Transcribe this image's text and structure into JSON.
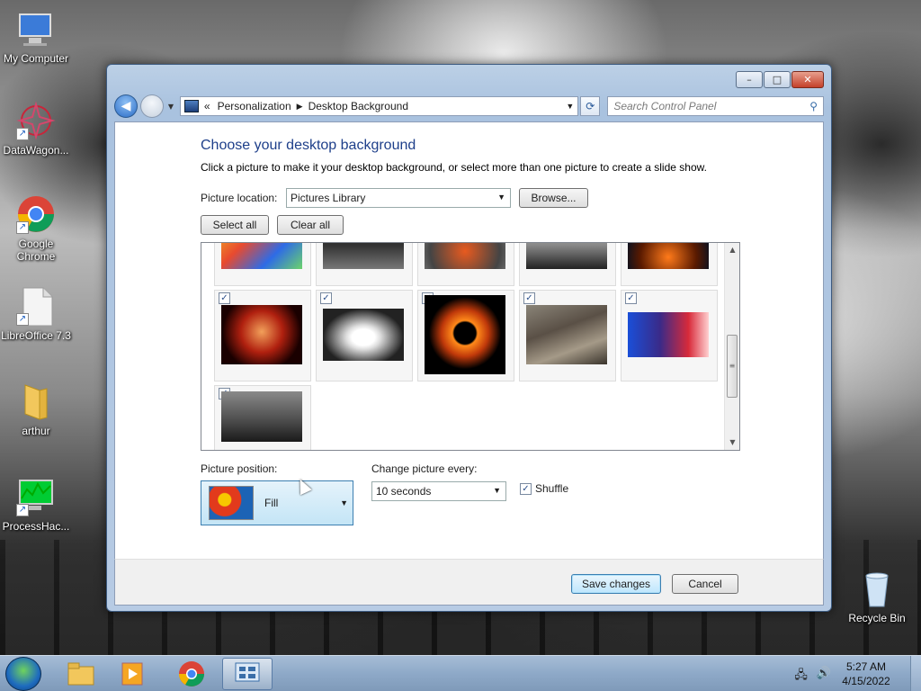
{
  "desktop": {
    "icons": [
      {
        "label": "My Computer"
      },
      {
        "label": "DataWagon..."
      },
      {
        "label": "Google Chrome"
      },
      {
        "label": "LibreOffice 7.3"
      },
      {
        "label": "arthur"
      },
      {
        "label": "ProcessHac..."
      },
      {
        "label": "Recycle Bin"
      }
    ]
  },
  "window": {
    "caption": {
      "minimize": "–",
      "maximize": "□",
      "close": "✕"
    },
    "nav": {
      "back_glyph": "◀",
      "address_prefix": "«",
      "crumb_1": "Personalization",
      "crumb_sep": "▶",
      "crumb_2": "Desktop Background",
      "search_placeholder": "Search Control Panel"
    },
    "heading": "Choose your desktop background",
    "subtitle": "Click a picture to make it your desktop background, or select more than one picture to create a slide show.",
    "picture_location_label": "Picture location:",
    "picture_location_value": "Pictures Library",
    "browse_label": "Browse...",
    "select_all_label": "Select all",
    "clear_all_label": "Clear all",
    "checkmark": "✓",
    "picture_position_label": "Picture position:",
    "picture_position_value": "Fill",
    "change_every_label": "Change picture every:",
    "change_every_value": "10 seconds",
    "shuffle_label": "Shuffle",
    "save_label": "Save changes",
    "cancel_label": "Cancel"
  },
  "taskbar": {
    "time": "5:27 AM",
    "date": "4/15/2022"
  },
  "colors": {
    "heading_blue": "#1e3f8a",
    "primary_button": "#bee6fd",
    "taskbar": "#8ea9c8"
  }
}
